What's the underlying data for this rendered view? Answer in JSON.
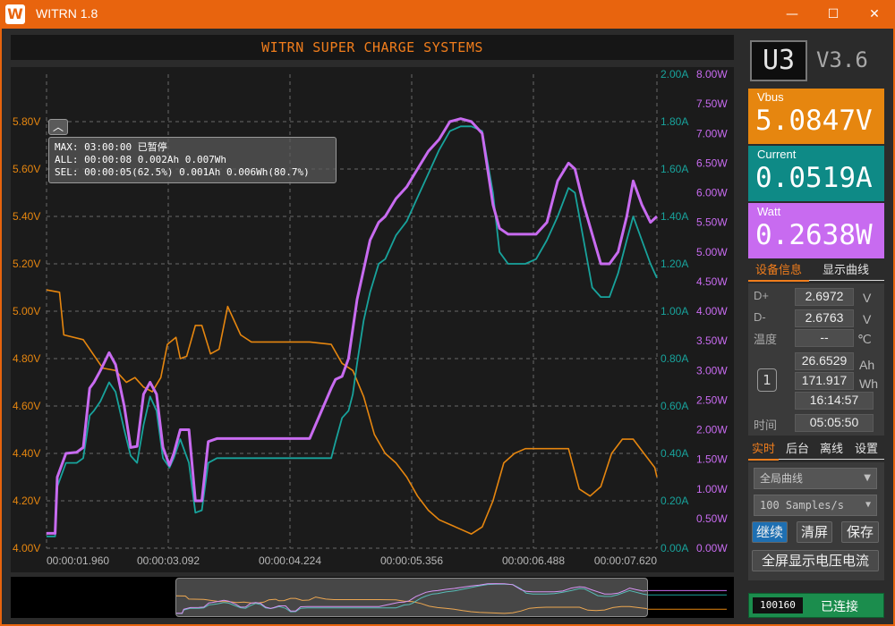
{
  "window": {
    "logo": "W",
    "title": "WITRN 1.8",
    "minimize": "—",
    "maximize": "☐",
    "close": "✕"
  },
  "header": {
    "title": "WITRN SUPER CHARGE SYSTEMS"
  },
  "info_box": {
    "collapse": "︿",
    "line1": "MAX: 03:00:00 已暂停",
    "line2": "ALL: 00:00:08 0.002Ah 0.007Wh",
    "line3": "SEL: 00:00:05(62.5%) 0.001Ah 0.006Wh(80.7%)"
  },
  "right": {
    "model": "U3",
    "version": "V3.6",
    "vbus": {
      "label": "Vbus",
      "value": "5.0847V",
      "color": "#e6860f"
    },
    "current": {
      "label": "Current",
      "value": "0.0519A",
      "color": "#0e8a86"
    },
    "watt": {
      "label": "Watt",
      "value": "0.2638W",
      "color": "#c86bf0"
    },
    "tabs1": [
      "设备信息",
      "显示曲线"
    ],
    "device": {
      "dplus_label": "D+",
      "dplus": "2.6972",
      "dplus_unit": "V",
      "dminus_label": "D-",
      "dminus": "2.6763",
      "dminus_unit": "V",
      "temp_label": "温度",
      "temp": "--",
      "temp_unit": "℃",
      "group": "1",
      "ah": "26.6529",
      "ah_unit": "Ah",
      "wh": "171.917",
      "wh_unit": "Wh",
      "time1": "16:14:57",
      "time_label": "时间",
      "time2": "05:05:50"
    },
    "tabs2": [
      "实时",
      "后台",
      "离线",
      "设置"
    ],
    "controls": {
      "curve_select": "全局曲线",
      "rate_select": "100 Samples/s",
      "continue": "继续",
      "clear": "清屏",
      "save": "保存",
      "fullscreen": "全屏显示电压电流"
    },
    "status": {
      "code": "100160",
      "text": "已连接"
    }
  },
  "chart_data": {
    "type": "line",
    "x_ticks": [
      "00:00:01.960",
      "00:00:03.092",
      "00:00:04.224",
      "00:00:05.356",
      "00:00:06.488",
      "00:00:07.620"
    ],
    "x_range_s": [
      1.96,
      7.62
    ],
    "voltage_axis": {
      "ticks": [
        "4.00V",
        "4.20V",
        "4.40V",
        "4.60V",
        "4.80V",
        "5.00V",
        "5.20V",
        "5.40V",
        "5.60V",
        "5.80V"
      ],
      "min": 4.0,
      "max": 6.0,
      "color": "#e6860f"
    },
    "current_axis": {
      "ticks": [
        "0.00A",
        "0.20A",
        "0.40A",
        "0.60A",
        "0.80A",
        "1.00A",
        "1.20A",
        "1.40A",
        "1.60A",
        "1.80A",
        "2.00A"
      ],
      "min": 0.0,
      "max": 2.0,
      "color": "#18a39c"
    },
    "power_axis": {
      "ticks": [
        "0.00W",
        "0.50W",
        "1.00W",
        "1.50W",
        "2.00W",
        "2.50W",
        "3.00W",
        "3.50W",
        "4.00W",
        "4.50W",
        "5.00W",
        "5.50W",
        "6.00W",
        "6.50W",
        "7.00W",
        "7.50W",
        "8.00W"
      ],
      "min": 0.0,
      "max": 8.0,
      "color": "#c86bf0"
    },
    "grid": true,
    "series": [
      {
        "name": "Vbus",
        "color": "#e6860f",
        "axis": "voltage",
        "x": [
          1.96,
          2.08,
          2.12,
          2.3,
          2.48,
          2.6,
          2.7,
          2.78,
          2.86,
          2.94,
          3.02,
          3.08,
          3.16,
          3.2,
          3.26,
          3.34,
          3.4,
          3.48,
          3.56,
          3.64,
          3.76,
          3.86,
          4.0,
          4.2,
          4.4,
          4.6,
          4.7,
          4.8,
          4.9,
          5.0,
          5.1,
          5.2,
          5.3,
          5.4,
          5.5,
          5.6,
          5.7,
          5.8,
          5.9,
          6.0,
          6.1,
          6.2,
          6.3,
          6.4,
          6.5,
          6.6,
          6.7,
          6.8,
          6.9,
          7.0,
          7.1,
          7.2,
          7.3,
          7.4,
          7.5,
          7.6,
          7.62
        ],
        "values": [
          5.09,
          5.08,
          4.9,
          4.88,
          4.76,
          4.75,
          4.7,
          4.72,
          4.68,
          4.66,
          4.72,
          4.86,
          4.89,
          4.8,
          4.81,
          4.94,
          4.94,
          4.82,
          4.84,
          5.02,
          4.9,
          4.87,
          4.87,
          4.87,
          4.87,
          4.86,
          4.78,
          4.75,
          4.64,
          4.48,
          4.4,
          4.36,
          4.3,
          4.22,
          4.16,
          4.12,
          4.1,
          4.08,
          4.06,
          4.09,
          4.2,
          4.36,
          4.4,
          4.42,
          4.42,
          4.42,
          4.42,
          4.42,
          4.25,
          4.22,
          4.26,
          4.4,
          4.46,
          4.46,
          4.4,
          4.34,
          4.3
        ]
      },
      {
        "name": "Current",
        "color": "#18a39c",
        "axis": "current",
        "x": [
          1.96,
          2.04,
          2.06,
          2.14,
          2.24,
          2.3,
          2.36,
          2.4,
          2.46,
          2.54,
          2.6,
          2.68,
          2.74,
          2.8,
          2.86,
          2.92,
          2.98,
          3.04,
          3.1,
          3.14,
          3.2,
          3.28,
          3.34,
          3.4,
          3.46,
          3.54,
          3.62,
          3.7,
          3.8,
          3.9,
          4.0,
          4.2,
          4.4,
          4.6,
          4.64,
          4.7,
          4.76,
          4.8,
          4.84,
          4.9,
          4.96,
          5.04,
          5.1,
          5.2,
          5.3,
          5.4,
          5.5,
          5.6,
          5.7,
          5.8,
          5.9,
          6.0,
          6.1,
          6.16,
          6.24,
          6.3,
          6.4,
          6.5,
          6.6,
          6.7,
          6.8,
          6.86,
          6.94,
          7.02,
          7.1,
          7.18,
          7.26,
          7.34,
          7.4,
          7.48,
          7.56,
          7.62
        ],
        "values": [
          0.05,
          0.05,
          0.26,
          0.36,
          0.36,
          0.38,
          0.56,
          0.58,
          0.62,
          0.7,
          0.66,
          0.5,
          0.39,
          0.36,
          0.52,
          0.64,
          0.58,
          0.38,
          0.34,
          0.38,
          0.46,
          0.36,
          0.15,
          0.16,
          0.36,
          0.38,
          0.38,
          0.38,
          0.38,
          0.38,
          0.38,
          0.38,
          0.38,
          0.38,
          0.45,
          0.55,
          0.58,
          0.65,
          0.78,
          0.96,
          1.08,
          1.2,
          1.22,
          1.32,
          1.38,
          1.48,
          1.58,
          1.68,
          1.76,
          1.78,
          1.78,
          1.76,
          1.5,
          1.25,
          1.2,
          1.2,
          1.2,
          1.22,
          1.3,
          1.4,
          1.52,
          1.5,
          1.3,
          1.1,
          1.06,
          1.06,
          1.16,
          1.3,
          1.4,
          1.3,
          1.2,
          1.14
        ]
      },
      {
        "name": "Watt",
        "color": "#c86bf0",
        "axis": "power",
        "x": [
          1.96,
          2.04,
          2.06,
          2.14,
          2.24,
          2.3,
          2.36,
          2.4,
          2.46,
          2.54,
          2.6,
          2.68,
          2.74,
          2.8,
          2.86,
          2.92,
          2.98,
          3.04,
          3.1,
          3.14,
          3.2,
          3.28,
          3.34,
          3.4,
          3.46,
          3.54,
          3.62,
          3.7,
          3.8,
          3.9,
          4.0,
          4.2,
          4.4,
          4.6,
          4.64,
          4.7,
          4.76,
          4.8,
          4.84,
          4.9,
          4.96,
          5.04,
          5.1,
          5.2,
          5.3,
          5.4,
          5.5,
          5.6,
          5.7,
          5.8,
          5.9,
          6.0,
          6.1,
          6.16,
          6.24,
          6.3,
          6.4,
          6.5,
          6.6,
          6.7,
          6.8,
          6.86,
          6.94,
          7.02,
          7.1,
          7.18,
          7.26,
          7.34,
          7.4,
          7.48,
          7.56,
          7.62
        ],
        "values": [
          0.25,
          0.25,
          1.2,
          1.6,
          1.62,
          1.7,
          2.7,
          2.8,
          3.0,
          3.3,
          3.1,
          2.4,
          1.7,
          1.72,
          2.6,
          2.8,
          2.6,
          1.7,
          1.4,
          1.6,
          2.0,
          2.0,
          0.8,
          0.8,
          1.8,
          1.85,
          1.85,
          1.85,
          1.85,
          1.85,
          1.85,
          1.85,
          1.85,
          2.7,
          2.85,
          2.9,
          3.2,
          3.7,
          4.2,
          4.7,
          5.2,
          5.5,
          5.6,
          5.9,
          6.1,
          6.4,
          6.7,
          6.9,
          7.2,
          7.25,
          7.2,
          7.0,
          5.8,
          5.4,
          5.3,
          5.3,
          5.3,
          5.3,
          5.5,
          6.2,
          6.5,
          6.4,
          5.8,
          5.3,
          4.8,
          4.8,
          5.0,
          5.6,
          6.2,
          5.8,
          5.5,
          5.6
        ]
      }
    ]
  }
}
